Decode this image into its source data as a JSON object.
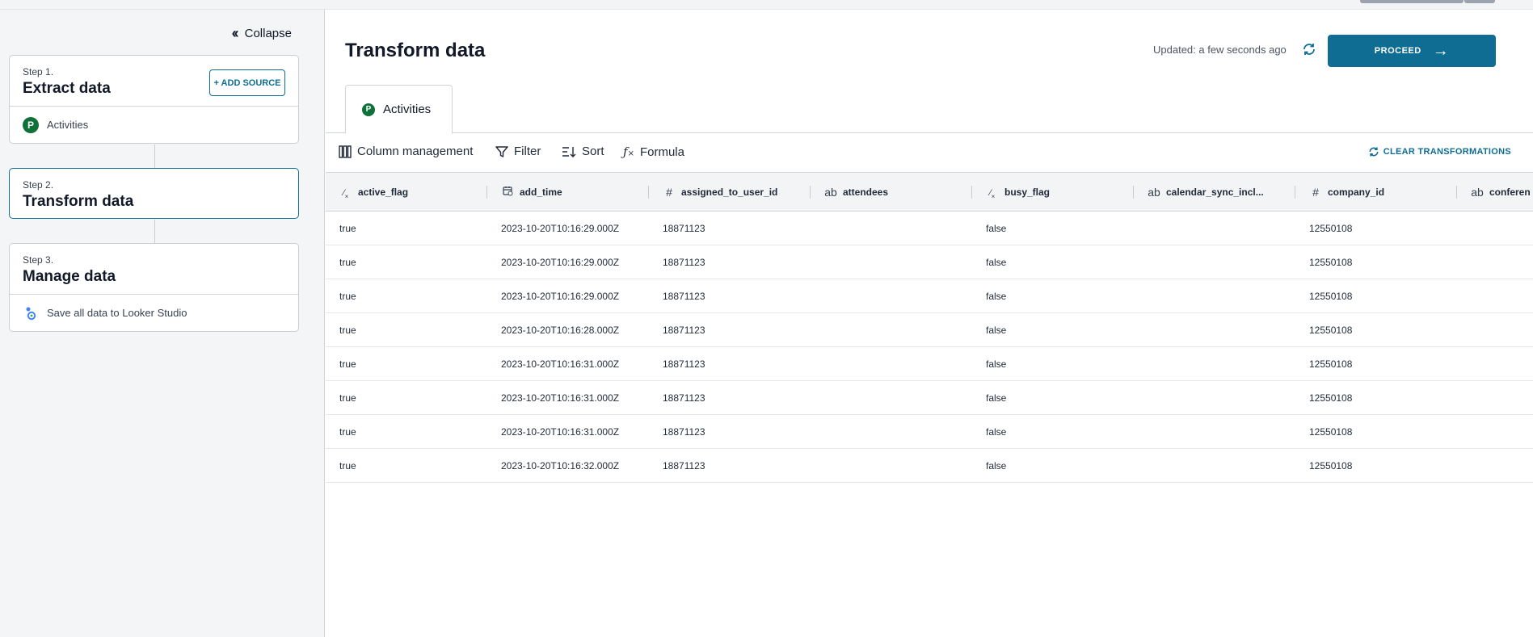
{
  "sidebar": {
    "collapse_label": "Collapse",
    "steps": [
      {
        "number": "Step 1.",
        "title": "Extract data",
        "button": "+ ADD SOURCE",
        "item": "Activities"
      },
      {
        "number": "Step 2.",
        "title": "Transform data"
      },
      {
        "number": "Step 3.",
        "title": "Manage data",
        "item": "Save all data to Looker Studio"
      }
    ]
  },
  "header": {
    "title": "Transform data",
    "updated": "Updated: a few seconds ago",
    "proceed_label": "PROCEED"
  },
  "tabs": [
    {
      "label": "Activities",
      "logo_letter": "P"
    }
  ],
  "toolbar": {
    "column_management": "Column management",
    "filter": "Filter",
    "sort": "Sort",
    "formula": "Formula",
    "clear": "CLEAR TRANSFORMATIONS"
  },
  "table": {
    "columns": [
      {
        "name": "active_flag",
        "type_icon": "boolean-icon"
      },
      {
        "name": "add_time",
        "type_icon": "datetime-icon"
      },
      {
        "name": "assigned_to_user_id",
        "type_icon": "number-icon"
      },
      {
        "name": "attendees",
        "type_icon": "text-icon"
      },
      {
        "name": "busy_flag",
        "type_icon": "boolean-icon"
      },
      {
        "name": "calendar_sync_incl...",
        "type_icon": "text-icon"
      },
      {
        "name": "company_id",
        "type_icon": "number-icon"
      },
      {
        "name": "conferen",
        "type_icon": "text-icon"
      }
    ],
    "rows": [
      [
        "true",
        "2023-10-20T10:16:29.000Z",
        "18871123",
        "",
        "false",
        "",
        "12550108",
        ""
      ],
      [
        "true",
        "2023-10-20T10:16:29.000Z",
        "18871123",
        "",
        "false",
        "",
        "12550108",
        ""
      ],
      [
        "true",
        "2023-10-20T10:16:29.000Z",
        "18871123",
        "",
        "false",
        "",
        "12550108",
        ""
      ],
      [
        "true",
        "2023-10-20T10:16:28.000Z",
        "18871123",
        "",
        "false",
        "",
        "12550108",
        ""
      ],
      [
        "true",
        "2023-10-20T10:16:31.000Z",
        "18871123",
        "",
        "false",
        "",
        "12550108",
        ""
      ],
      [
        "true",
        "2023-10-20T10:16:31.000Z",
        "18871123",
        "",
        "false",
        "",
        "12550108",
        ""
      ],
      [
        "true",
        "2023-10-20T10:16:31.000Z",
        "18871123",
        "",
        "false",
        "",
        "12550108",
        ""
      ],
      [
        "true",
        "2023-10-20T10:16:32.000Z",
        "18871123",
        "",
        "false",
        "",
        "12550108",
        ""
      ]
    ]
  },
  "colors": {
    "accent": "#0f6d94",
    "pipedrive_green": "#10703a",
    "sidebar_bg": "#f4f5f7"
  }
}
